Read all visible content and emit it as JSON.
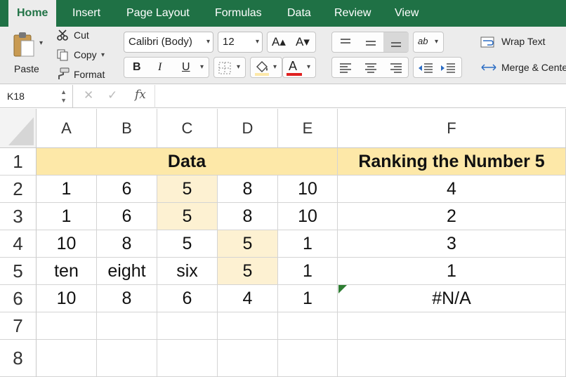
{
  "ribbon_tabs": [
    "Home",
    "Insert",
    "Page Layout",
    "Formulas",
    "Data",
    "Review",
    "View"
  ],
  "clipboard": {
    "paste_label": "Paste",
    "cut_label": "Cut",
    "copy_label": "Copy",
    "format_label": "Format"
  },
  "font": {
    "family_value": "Calibri (Body)",
    "size_value": "12",
    "bold": "B",
    "italic": "I",
    "underline": "U"
  },
  "alignment": {
    "wrap_text_label": "Wrap Text",
    "merge_center_label": "Merge & Cente"
  },
  "formula_bar": {
    "name_box": "K18",
    "fx": "fx",
    "formula": ""
  },
  "sheet": {
    "columns": [
      "A",
      "B",
      "C",
      "D",
      "E",
      "F"
    ],
    "rows": [
      "1",
      "2",
      "3",
      "4",
      "5",
      "6",
      "7",
      "8"
    ],
    "header_data": "Data",
    "header_ranking": "Ranking the Number 5",
    "data_rows": [
      [
        "1",
        "6",
        "5",
        "8",
        "10",
        "4"
      ],
      [
        "1",
        "6",
        "5",
        "8",
        "10",
        "2"
      ],
      [
        "10",
        "8",
        "5",
        "5",
        "1",
        "3"
      ],
      [
        "ten",
        "eight",
        "six",
        "5",
        "1",
        "1"
      ],
      [
        "10",
        "8",
        "6",
        "4",
        "1",
        "#N/A"
      ]
    ]
  },
  "colors": {
    "ribbon_green": "#1f7145",
    "title_band": "#fde8a8",
    "highlight": "#fdf1d2",
    "font_color_bar": "#e02020",
    "error_indicator": "#2e7d32"
  }
}
